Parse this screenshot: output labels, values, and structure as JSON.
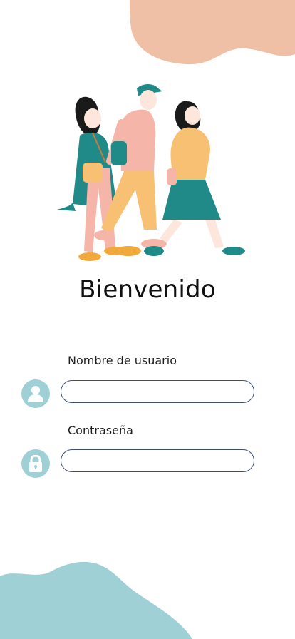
{
  "title": "Bienvenido",
  "username": {
    "label": "Nombre de usuario",
    "value": "",
    "placeholder": ""
  },
  "password": {
    "label": "Contraseña",
    "value": "",
    "placeholder": ""
  },
  "colors": {
    "top_blob": "#efbfa6",
    "bottom_blob": "#9fd0d5",
    "icon_bg": "#9fd0d5",
    "input_border": "#3f4f7a"
  },
  "icons": {
    "user": "user-icon",
    "lock": "lock-icon"
  }
}
